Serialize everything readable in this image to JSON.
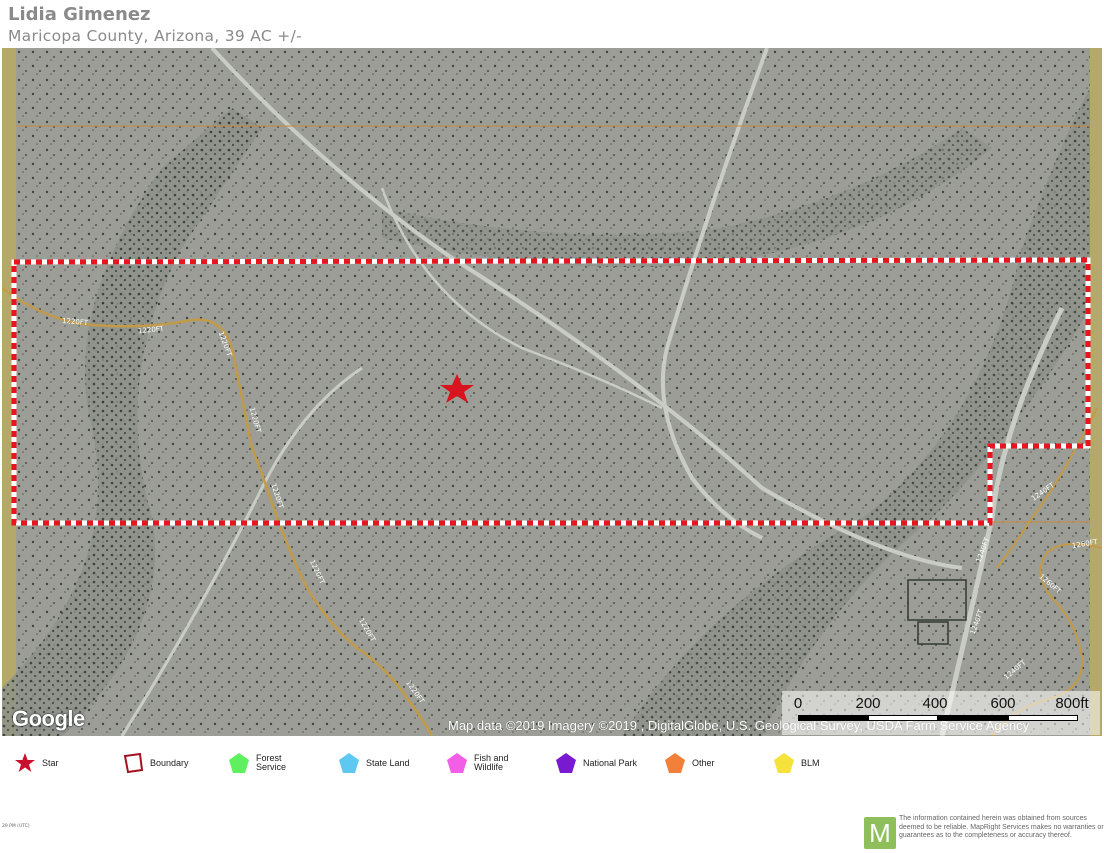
{
  "header": {
    "owner": "Lidia Gimenez",
    "location": "Maricopa County, Arizona, 39 AC +/-"
  },
  "map": {
    "contour_labels": [
      "1220FT",
      "1240FT",
      "1260FT"
    ],
    "attribution": "Map data ©2019  Imagery ©2019 , DigitalGlobe, U.S. Geological Survey, USDA Farm Service Agency",
    "google_logo": "Google",
    "scale_labels": [
      "0",
      "200",
      "400",
      "600",
      "800ft"
    ],
    "boundary_color": "#e8141e",
    "star_color": "#d8141e"
  },
  "legend": {
    "items": [
      {
        "label": "Star",
        "icon": "star-icon",
        "color": "#c8102e"
      },
      {
        "label": "Boundary",
        "icon": "boundary-icon",
        "color": "#a0121e"
      },
      {
        "label": "Forest Service",
        "icon": "forest-service-icon",
        "color": "#5ef05e"
      },
      {
        "label": "State Land",
        "icon": "state-land-icon",
        "color": "#5ec8f0"
      },
      {
        "label": "Fish and Wildlife",
        "icon": "fish-wildlife-icon",
        "color": "#f25ee6"
      },
      {
        "label": "National Park",
        "icon": "national-park-icon",
        "color": "#7a1ad0"
      },
      {
        "label": "Other",
        "icon": "other-icon",
        "color": "#f2803a"
      },
      {
        "label": "BLM",
        "icon": "blm-icon",
        "color": "#f5e23a"
      }
    ]
  },
  "footer": {
    "left_note": "29 PM (UTC)",
    "logo_letter": "M",
    "disclaimer": "The information contained herein was obtained from sources deemed to be reliable. MapRight Services makes no warranties or guarantees as to the completeness or accuracy thereof."
  }
}
